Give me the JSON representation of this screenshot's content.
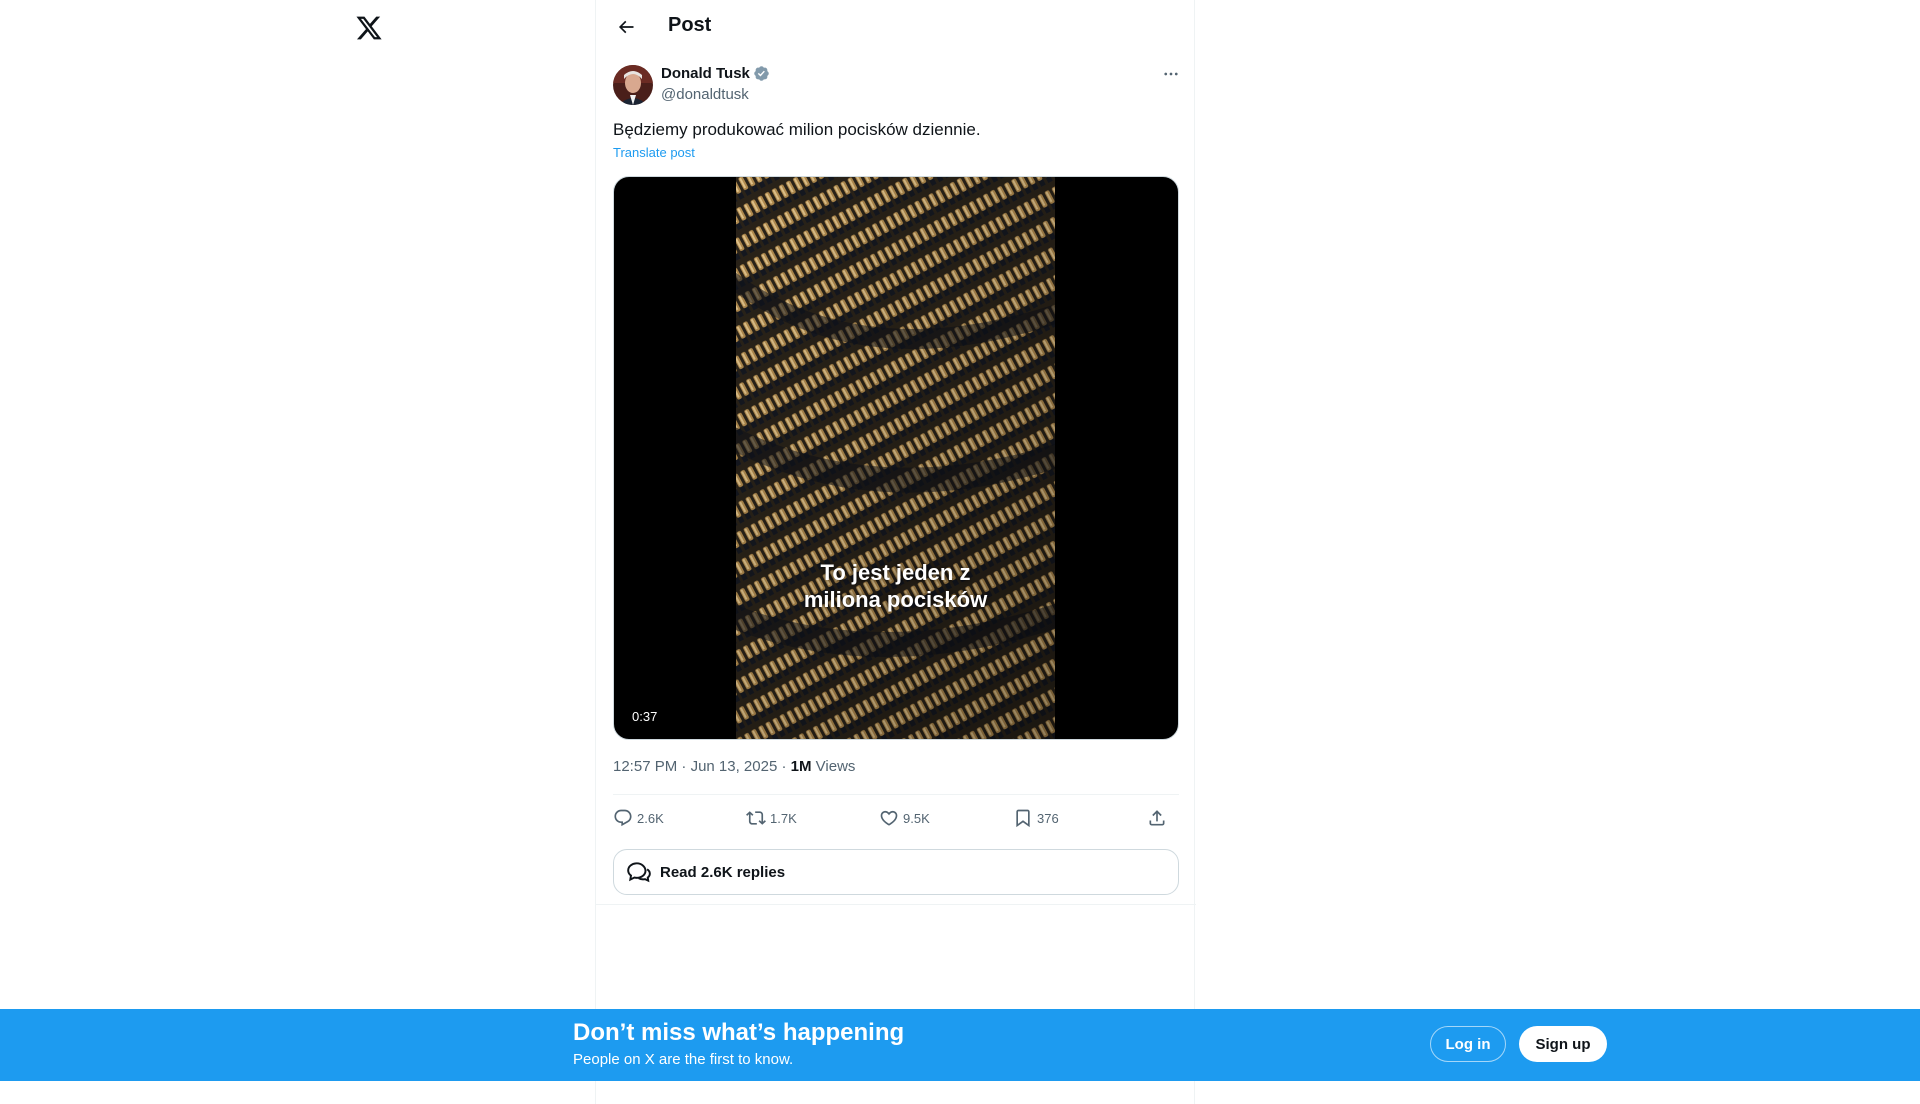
{
  "header": {
    "title": "Post"
  },
  "post": {
    "author_name": "Donald Tusk",
    "author_handle": "@donaldtusk",
    "text": "Będziemy produkować milion pocisków dziennie.",
    "translate_label": "Translate post",
    "video_caption_line1": "To jest jeden z",
    "video_caption_line2": "miliona pocisków",
    "duration": "0:37",
    "time": "12:57 PM",
    "date": "Jun 13, 2025",
    "views_count": "1M",
    "views_label": "Views"
  },
  "actions": {
    "replies": "2.6K",
    "reposts": "1.7K",
    "likes": "9.5K",
    "bookmarks": "376"
  },
  "read_replies_label": "Read 2.6K replies",
  "banner": {
    "title": "Don’t miss what’s happening",
    "subtitle": "People on X are the first to know.",
    "login_label": "Log in",
    "signup_label": "Sign up"
  },
  "colors": {
    "accent": "#1d9bf0",
    "text": "#0f1419",
    "muted": "#536471",
    "verified": "#829aab"
  },
  "icons": [
    "x-logo-icon",
    "back-arrow-icon",
    "verified-badge-icon",
    "more-icon",
    "reply-icon",
    "repost-icon",
    "like-icon",
    "bookmark-icon",
    "share-icon",
    "chat-bubbles-icon"
  ]
}
